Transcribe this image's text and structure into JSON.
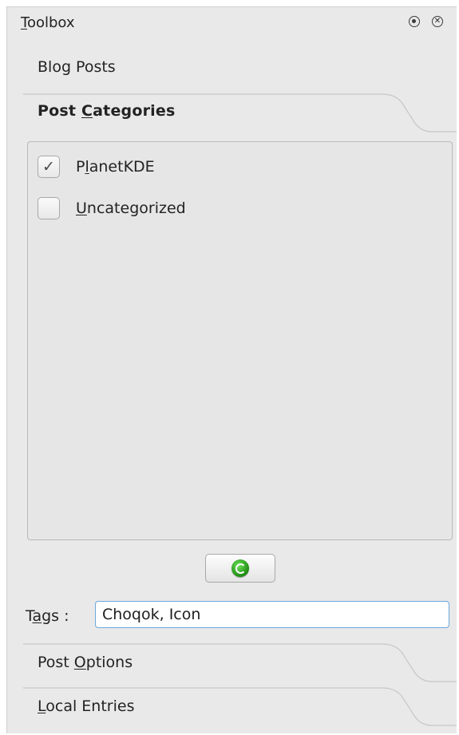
{
  "title": {
    "text": "Toolbox",
    "mnemonic": "T",
    "rest": "oolbox"
  },
  "sections": {
    "blog_posts": "Blog Posts",
    "post_categories": {
      "before": "Post ",
      "mnemonic": "C",
      "after": "ategories"
    },
    "post_options": {
      "before": "Post ",
      "mnemonic": "O",
      "after": "ptions"
    },
    "local_entries": {
      "before": "",
      "mnemonic": "L",
      "after": "ocal Entries"
    }
  },
  "categories": [
    {
      "before": "P",
      "mnemonic": "l",
      "after": "anetKDE",
      "checked": true
    },
    {
      "before": "",
      "mnemonic": "U",
      "after": "ncategorized",
      "checked": false
    }
  ],
  "tags": {
    "label_before": "T",
    "label_mnemonic": "a",
    "label_after": "gs :",
    "value": "Choqok, Icon"
  },
  "icons": {
    "float": "float-window-icon",
    "close": "close-window-icon",
    "refresh": "reload-icon",
    "check": "checkmark-icon"
  },
  "colors": {
    "panel_bg": "#e9e9e9",
    "input_border": "#6aa7dc",
    "refresh_green": "#1f8a12"
  }
}
